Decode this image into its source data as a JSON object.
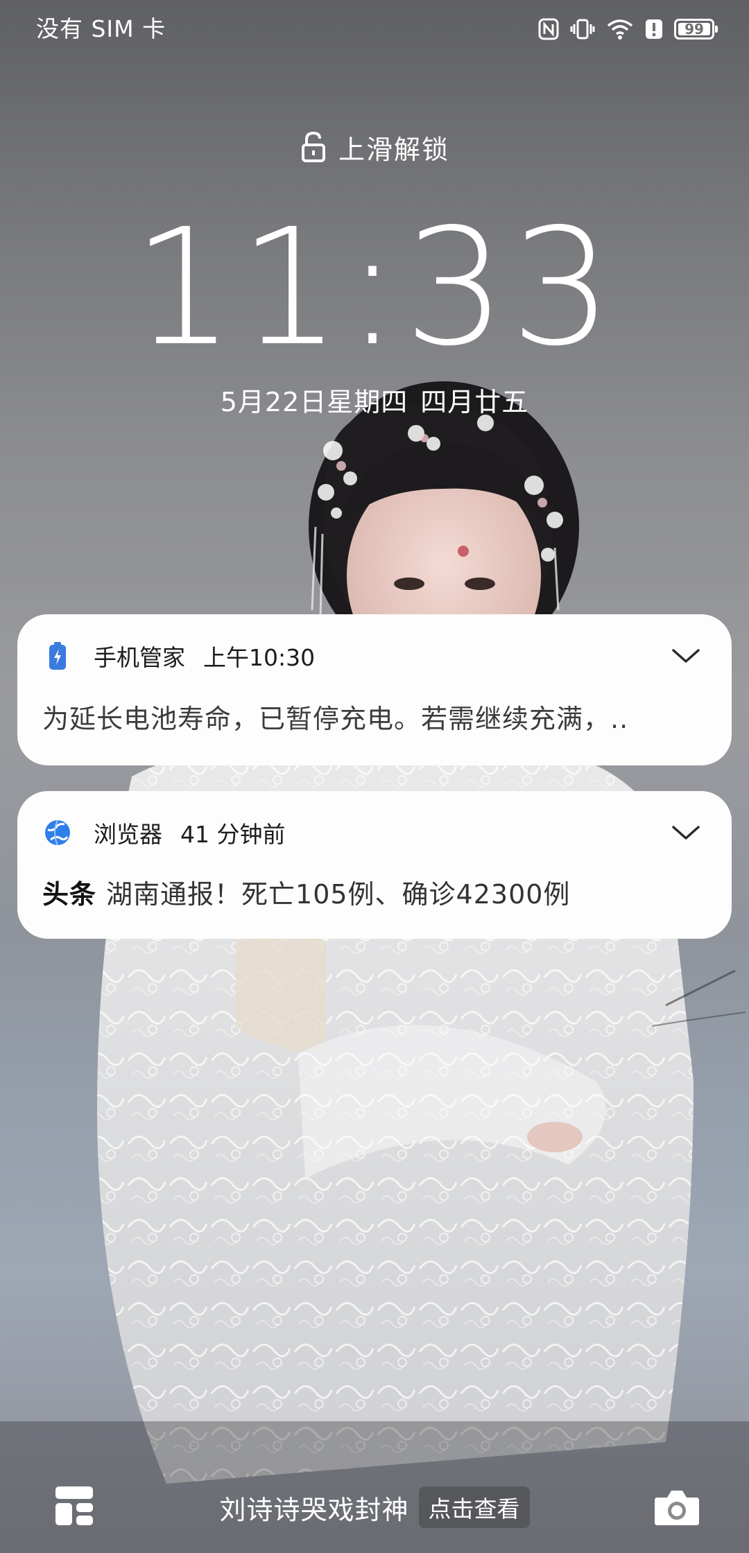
{
  "status_bar": {
    "carrier": "没有 SIM 卡",
    "battery_level": "99",
    "icons": [
      "nfc-icon",
      "vibrate-icon",
      "wifi-icon",
      "alert-icon",
      "battery-icon"
    ]
  },
  "lock": {
    "unlock_hint": "上滑解锁",
    "unlock_icon": "unlock-icon",
    "time": "11:33",
    "date": "5月22日星期四",
    "lunar_date": "四月廿五"
  },
  "notifications": [
    {
      "app_icon": "battery-charge-icon",
      "app_name": "手机管家",
      "time": "上午10:30",
      "body": "为延长电池寿命，已暂停充电。若需继续充满，.."
    },
    {
      "app_icon": "browser-globe-icon",
      "app_name": "浏览器",
      "time": "41 分钟前",
      "tag": "头条",
      "body": "湖南通报！死亡105例、确诊42300例"
    }
  ],
  "bottom_bar": {
    "headline": "刘诗诗哭戏封神",
    "action": "点击查看",
    "left_icon": "widget-icon",
    "right_icon": "camera-icon"
  },
  "colors": {
    "card_bg": "#fdfdfd",
    "battery_icon": "#3a7be0",
    "browser_icon": "#2f7fe8",
    "text_primary": "#1c1c1c"
  }
}
